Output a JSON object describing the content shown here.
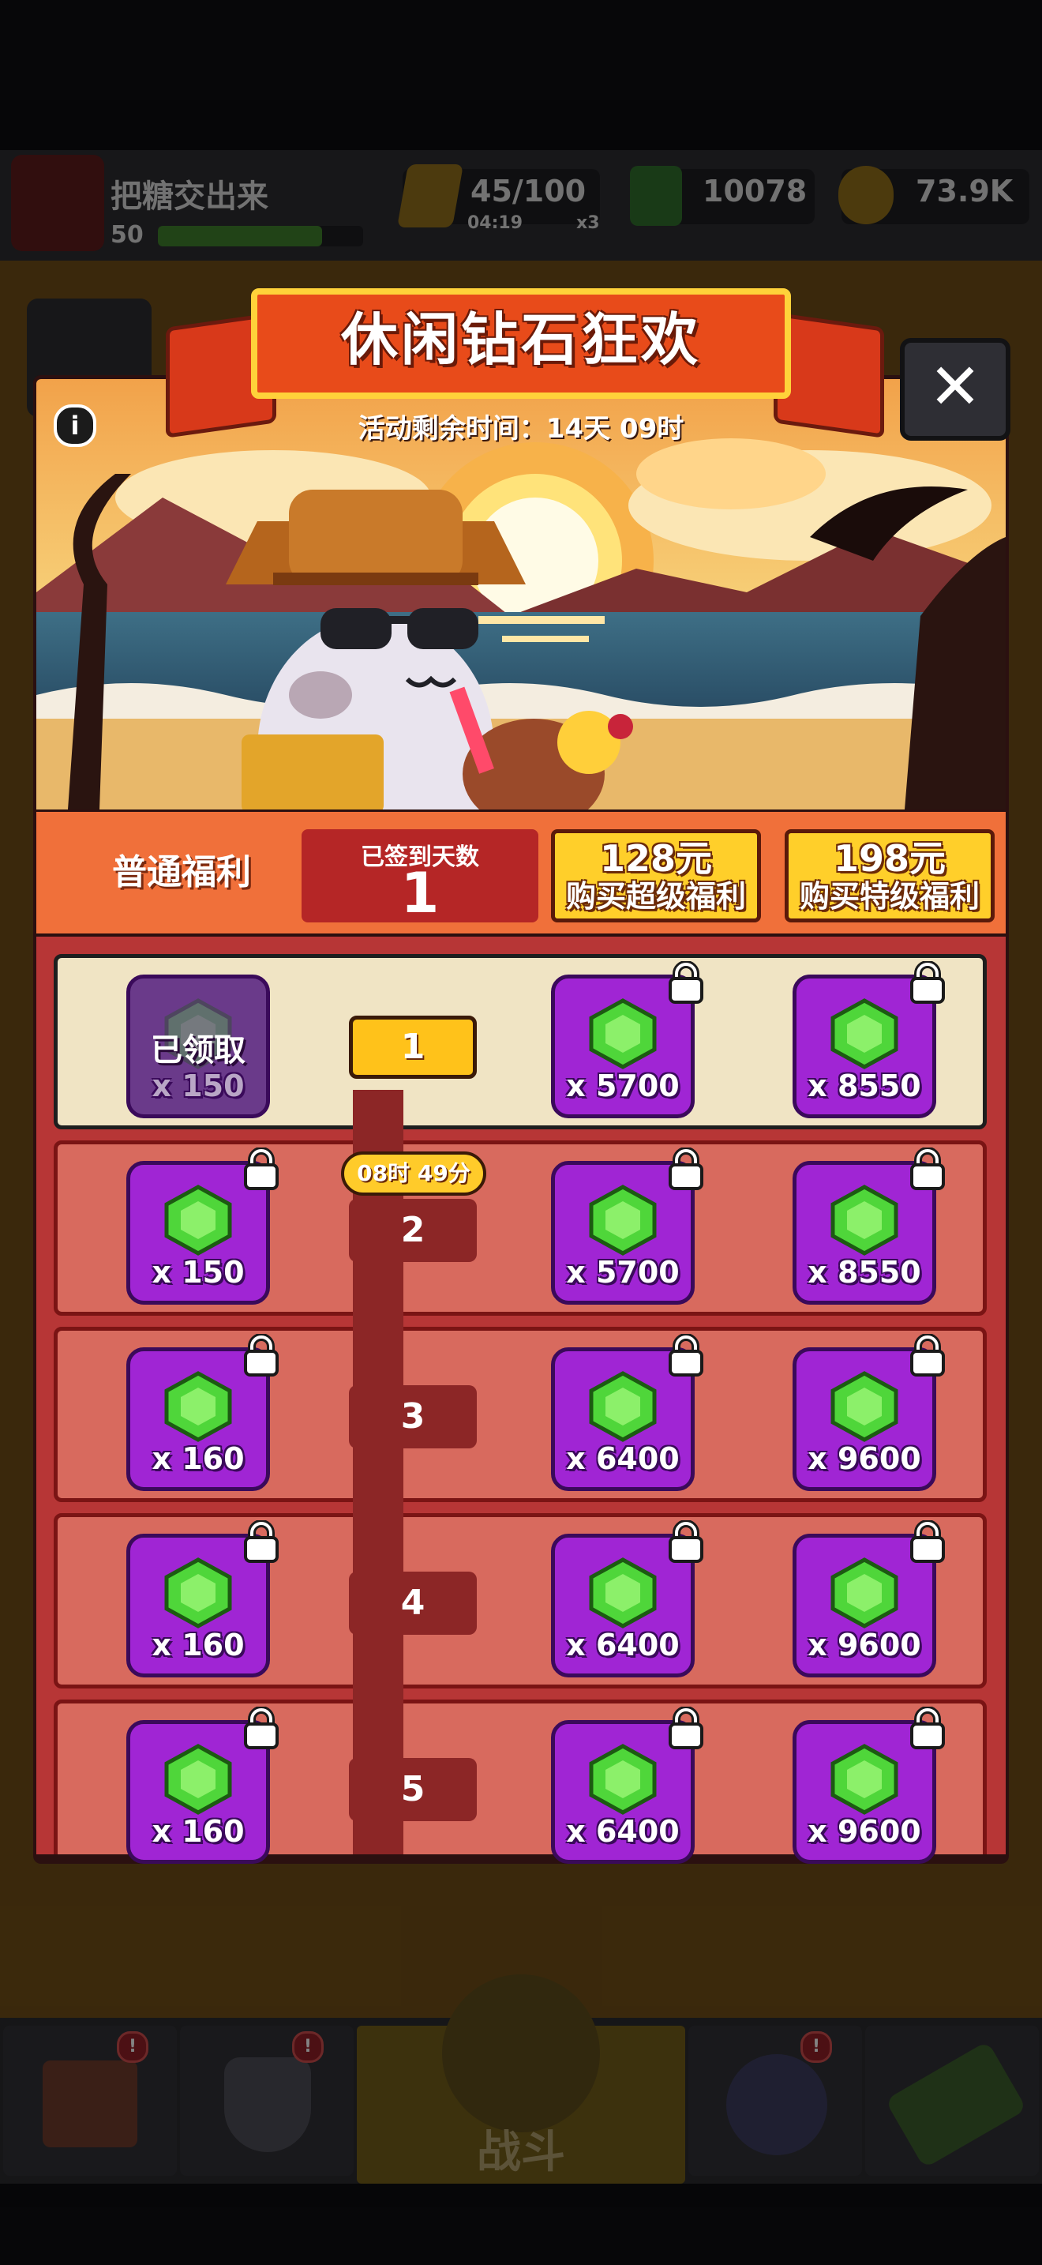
{
  "hud": {
    "player_name": "把糖交出来",
    "level": "50",
    "energy": "45/100",
    "energy_timer": "04:19",
    "energy_multiplier": "x3",
    "gems": "10078",
    "coins": "73.9K"
  },
  "event": {
    "title": "休闲钻石狂欢",
    "remaining_time": "活动剩余时间：14天 09时"
  },
  "welfare": {
    "label": "普通福利",
    "signed_days_label": "已签到天数",
    "signed_days": "1",
    "super_price": "128元",
    "super_label": "购买超级福利",
    "special_price": "198元",
    "special_label": "购买特级福利"
  },
  "rows": [
    {
      "day": "1",
      "free": "x 150",
      "super": "x 5700",
      "special": "x 8550",
      "claimed_label": "已领取"
    },
    {
      "day": "2",
      "free": "x 150",
      "super": "x 5700",
      "special": "x 8550"
    },
    {
      "day": "3",
      "free": "x 160",
      "super": "x 6400",
      "special": "x 9600"
    },
    {
      "day": "4",
      "free": "x 160",
      "super": "x 6400",
      "special": "x 9600"
    },
    {
      "day": "5",
      "free": "x 160",
      "super": "x 6400",
      "special": "x 9600"
    }
  ],
  "next_countdown": "08时 49分",
  "nav": {
    "battle_label": "战斗"
  },
  "icons": [
    "info-icon",
    "close-icon",
    "gem-icon",
    "lock-icon",
    "menu-icon",
    "shop-icon",
    "shield-icon",
    "ball-icon",
    "scroll-icon",
    "energy-icon",
    "coin-icon"
  ],
  "colors": {
    "accent_orange": "#f0703a",
    "gem_green": "#4fd63a",
    "item_purple": "#a025d4",
    "gold": "#ffcf2a"
  }
}
